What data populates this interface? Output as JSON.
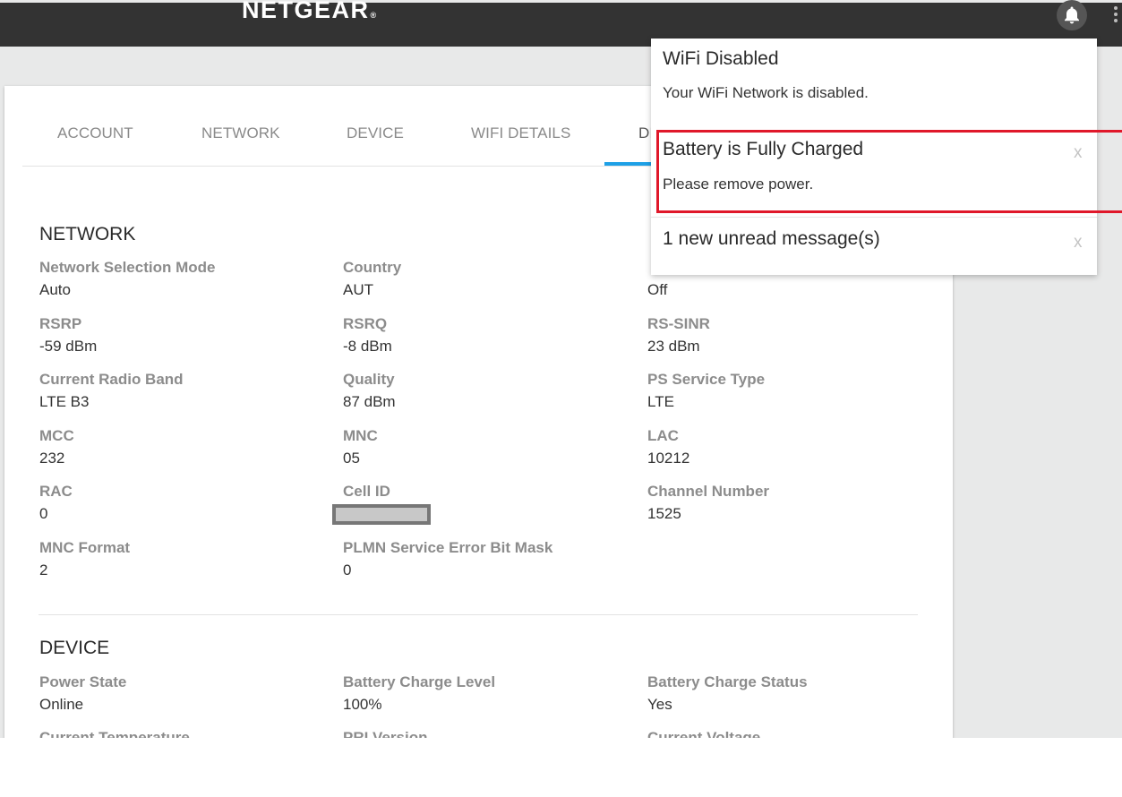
{
  "brand": {
    "logo": "NETGEAR",
    "trademark": "®"
  },
  "icons": {
    "bell": "bell-icon",
    "menu": "kebab-menu-icon",
    "close": "close-icon"
  },
  "colors": {
    "topbar": "#333333",
    "accent": "#1ea0e6",
    "highlight": "#e0182a"
  },
  "tabs": [
    {
      "label": "ACCOUNT"
    },
    {
      "label": "NETWORK"
    },
    {
      "label": "DEVICE"
    },
    {
      "label": "WIFI DETAILS"
    },
    {
      "label": "DI",
      "active": true
    }
  ],
  "network": {
    "title": "NETWORK",
    "fields": [
      {
        "label": "Network Selection Mode",
        "value": "Auto"
      },
      {
        "label": "Country",
        "value": "AUT"
      },
      {
        "label": "",
        "value": "Off"
      },
      {
        "label": "RSRP",
        "value": "-59 dBm"
      },
      {
        "label": "RSRQ",
        "value": "-8 dBm"
      },
      {
        "label": "RS-SINR",
        "value": "23 dBm"
      },
      {
        "label": "Current Radio Band",
        "value": "LTE B3"
      },
      {
        "label": "Quality",
        "value": "87 dBm"
      },
      {
        "label": "PS Service Type",
        "value": "LTE"
      },
      {
        "label": "MCC",
        "value": "232"
      },
      {
        "label": "MNC",
        "value": "05"
      },
      {
        "label": "LAC",
        "value": "10212"
      },
      {
        "label": "RAC",
        "value": "0"
      },
      {
        "label": "Cell ID",
        "value": ""
      },
      {
        "label": "Channel Number",
        "value": "1525"
      },
      {
        "label": "MNC Format",
        "value": "2"
      },
      {
        "label": "PLMN Service Error Bit Mask",
        "value": "0"
      }
    ]
  },
  "device": {
    "title": "DEVICE",
    "fields": [
      {
        "label": "Power State",
        "value": "Online"
      },
      {
        "label": "Battery Charge Level",
        "value": "100%"
      },
      {
        "label": "Battery Charge Status",
        "value": "Yes"
      },
      {
        "label": "Current Temperature",
        "value": ""
      },
      {
        "label": "PRI Version",
        "value": ""
      },
      {
        "label": "Current Voltage",
        "value": ""
      }
    ]
  },
  "notifications": [
    {
      "title": "WiFi Disabled",
      "body": "Your WiFi Network is disabled."
    },
    {
      "title": "Battery is Fully Charged",
      "body": "Please remove power.",
      "close": "x"
    },
    {
      "title": "1 new unread message(s)",
      "body": "",
      "close": "x"
    }
  ]
}
